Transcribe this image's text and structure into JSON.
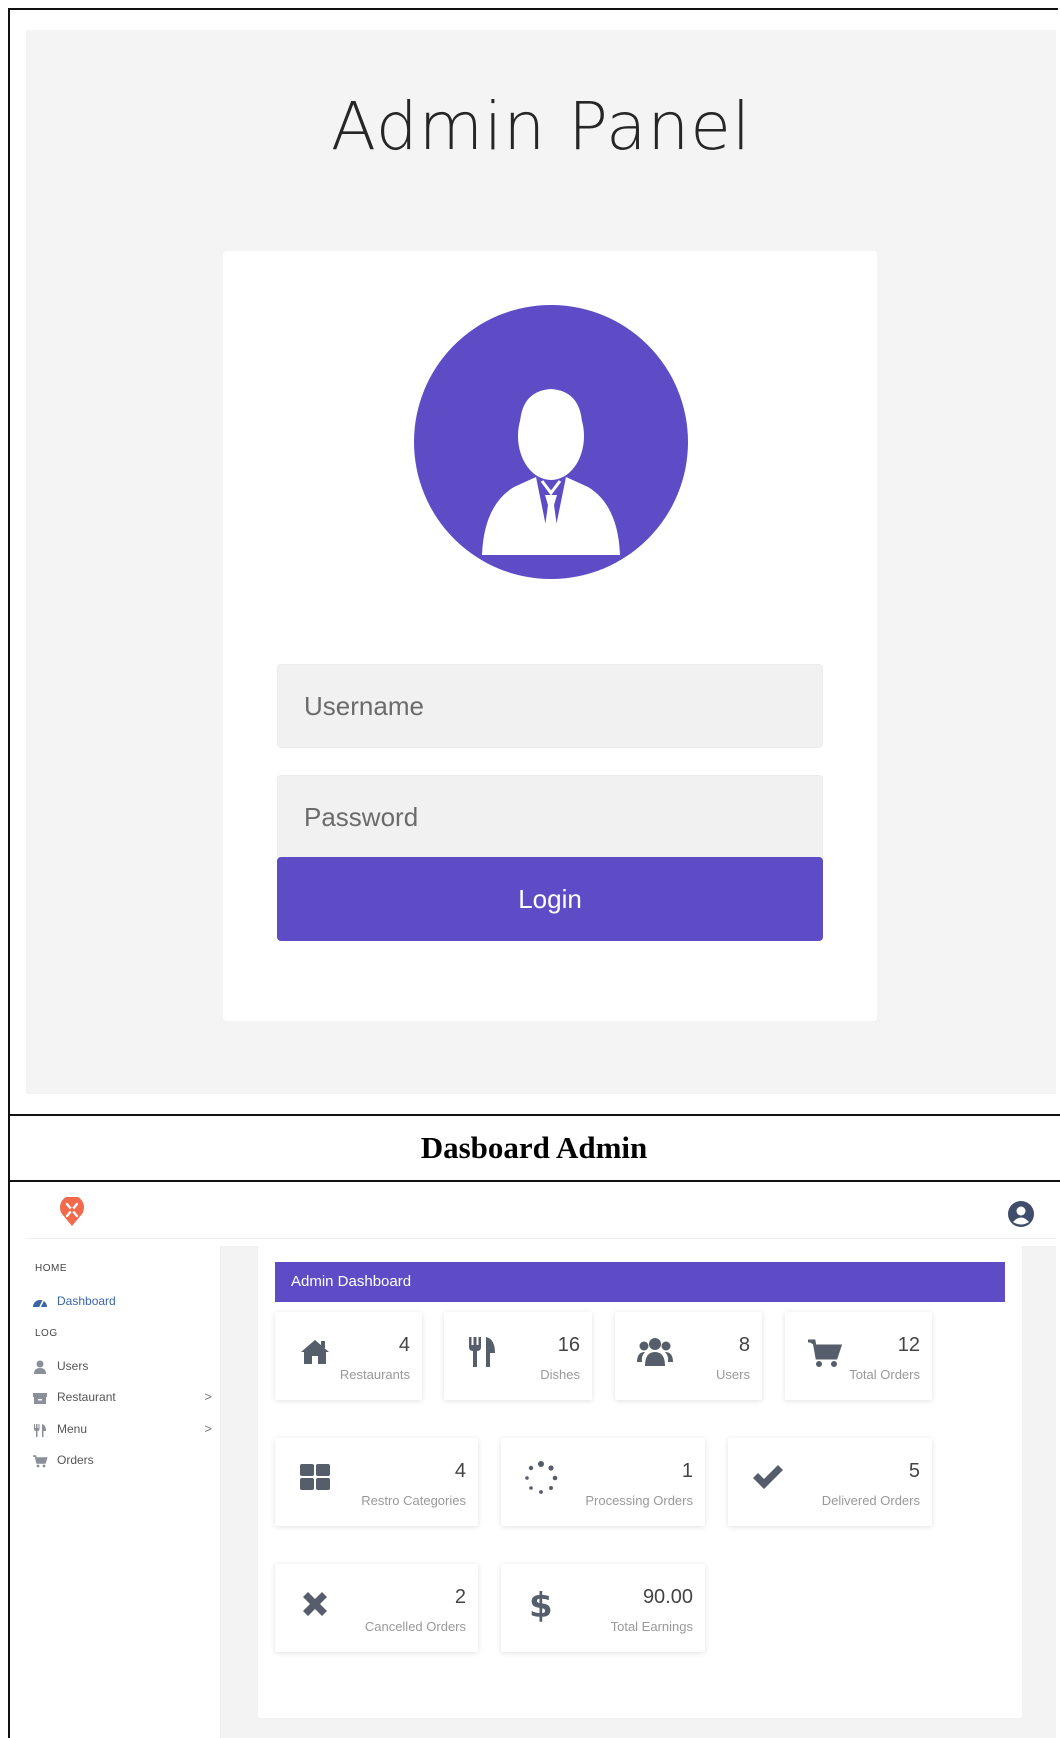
{
  "login": {
    "title": "Admin Panel",
    "username_placeholder": "Username",
    "password_placeholder": "Password",
    "login_label": "Login",
    "accent": "#5d4cc6"
  },
  "caption": "Dasboard Admin",
  "dashboard": {
    "logo_icon": "restaurant-logo-icon",
    "profile_icon": "user-circle-icon",
    "sidebar": {
      "sections": [
        "HOME",
        "LOG"
      ],
      "items": [
        {
          "label": "Dashboard",
          "icon": "dashboard-gauge-icon",
          "active": true
        },
        {
          "label": "Users",
          "icon": "user-icon"
        },
        {
          "label": "Restaurant",
          "icon": "archive-icon",
          "chevron": ">"
        },
        {
          "label": "Menu",
          "icon": "cutlery-icon",
          "chevron": ">"
        },
        {
          "label": "Orders",
          "icon": "cart-icon"
        }
      ]
    },
    "panel_title": "Admin Dashboard",
    "stats": [
      {
        "value": "4",
        "label": "Restaurants",
        "icon": "home-icon"
      },
      {
        "value": "16",
        "label": "Dishes",
        "icon": "cutlery-icon"
      },
      {
        "value": "8",
        "label": "Users",
        "icon": "users-icon"
      },
      {
        "value": "12",
        "label": "Total Orders",
        "icon": "cart-icon"
      },
      {
        "value": "4",
        "label": "Restro Categories",
        "icon": "grid-icon"
      },
      {
        "value": "1",
        "label": "Processing Orders",
        "icon": "spinner-icon"
      },
      {
        "value": "5",
        "label": "Delivered Orders",
        "icon": "check-icon"
      },
      {
        "value": "2",
        "label": "Cancelled Orders",
        "icon": "close-icon"
      },
      {
        "value": "90.00",
        "label": "Total Earnings",
        "icon": "dollar-icon"
      }
    ]
  }
}
